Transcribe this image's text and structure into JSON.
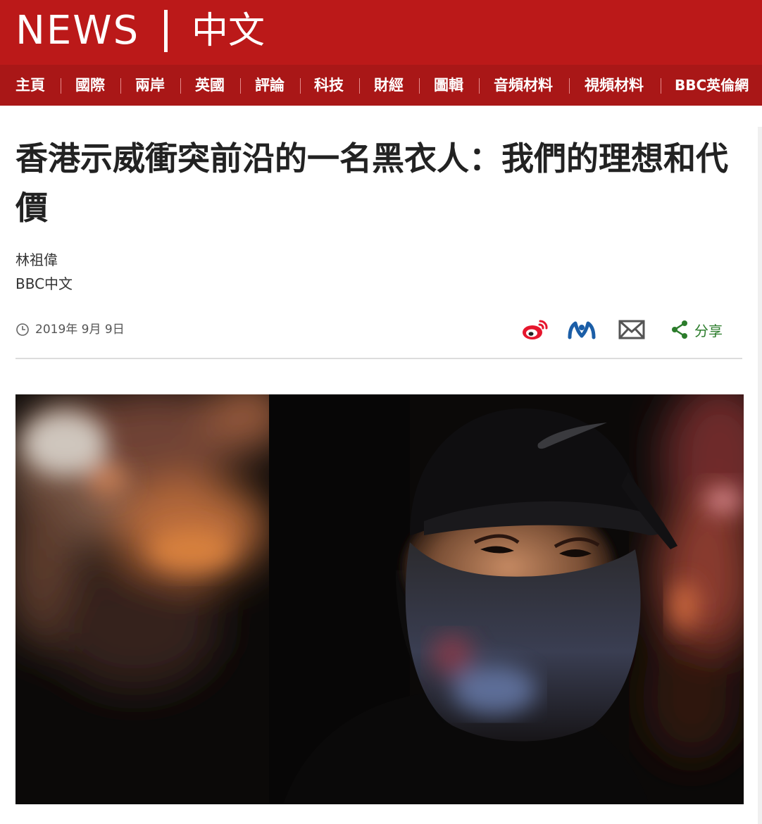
{
  "masthead": {
    "brand": "NEWS",
    "edition": "中文",
    "bg_color": "#bb1919"
  },
  "nav": {
    "items": [
      "主頁",
      "國際",
      "兩岸",
      "英國",
      "評論",
      "科技",
      "財經",
      "圖輯",
      "音頻材料",
      "視頻材料",
      "BBC英倫網"
    ]
  },
  "article": {
    "headline": "香港示威衝突前沿的一名黑衣人：我們的理想和代價",
    "author": "林祖偉",
    "organization": "BBC中文",
    "date": "2019年 9月 9日"
  },
  "share": {
    "icons": [
      "weibo-icon",
      "renren-icon",
      "email-icon",
      "share-icon"
    ],
    "label": "分享",
    "accent_color": "#2b7c2b"
  },
  "hero_image": {
    "description_icon": "photo-masked-protester"
  }
}
